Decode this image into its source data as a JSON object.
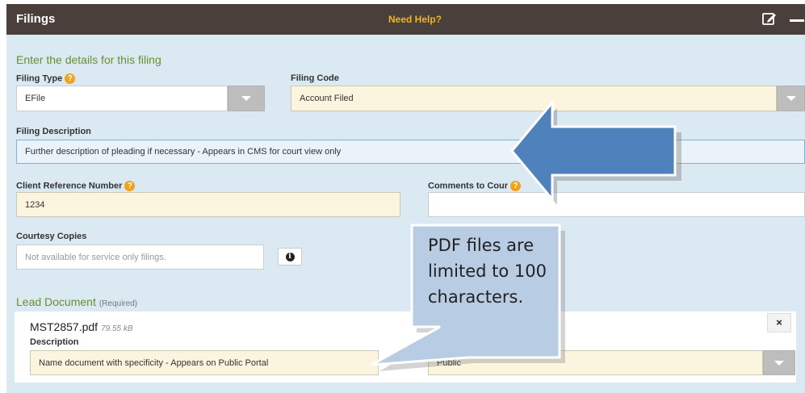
{
  "header": {
    "title": "Filings",
    "help_link": "Need Help?"
  },
  "form": {
    "section_title": "Enter the details for this filing",
    "filing_type": {
      "label": "Filing Type",
      "help": "?",
      "value": "EFile"
    },
    "filing_code": {
      "label": "Filing Code",
      "value": "Account Filed"
    },
    "filing_description": {
      "label": "Filing Description",
      "value": "Further description of pleading if necessary - Appears in CMS for court view only"
    },
    "client_reference": {
      "label": "Client Reference Number",
      "help": "?",
      "value": "1234"
    },
    "comments_to_court": {
      "label": "Comments to Cour",
      "help": "?",
      "value": ""
    },
    "courtesy_copies": {
      "label": "Courtesy Copies",
      "placeholder": "Not available for service only filings.",
      "info": "i"
    }
  },
  "lead_document": {
    "title": "Lead Document",
    "required": "(Required)",
    "file_name": "MST2857.pdf",
    "file_size": "79.55 kB",
    "close": "×",
    "description_label": "Description",
    "description_value": "Name document with specificity - Appears on Public Portal",
    "security_value": "Public"
  },
  "annotation": {
    "callout_text": "PDF files are limited to 100 characters."
  },
  "colors": {
    "header_bg": "#4a3f3a",
    "help_link": "#f0b429",
    "panel_bg": "#dbe9f3",
    "field_bg": "#fbf4de",
    "section_title": "#6a8e33",
    "arrow": "#4f81bd",
    "callout": "#b8cce4"
  }
}
